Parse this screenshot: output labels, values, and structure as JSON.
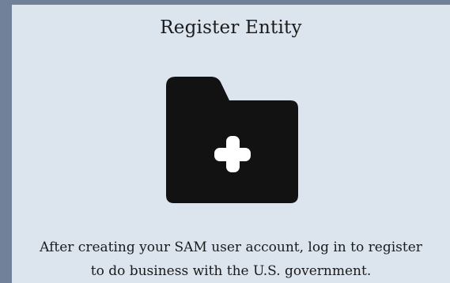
{
  "card": {
    "title": "Register Entity",
    "icon": "folder-plus-icon",
    "description_lines": [
      "After creating your SAM user account, log in to register",
      "to do business with the U.S. government."
    ]
  },
  "colors": {
    "page_background": "#71819a",
    "card_background": "#dce4ee",
    "text": "#1b1b1b",
    "icon": "#121212"
  }
}
